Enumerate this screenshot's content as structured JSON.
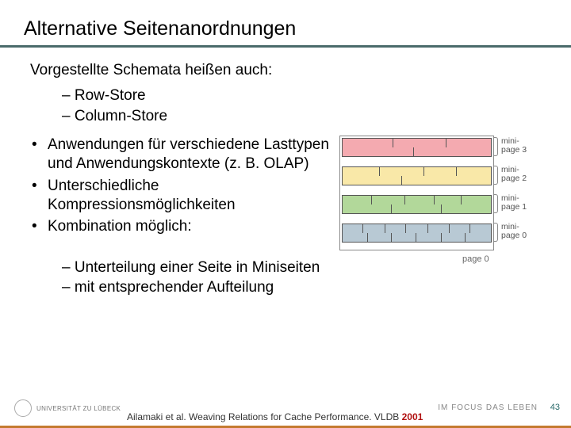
{
  "title": "Alternative Seitenanordnungen",
  "intro": "Vorgestellte Schemata heißen auch:",
  "stores": [
    "Row-Store",
    "Column-Store"
  ],
  "bullets": [
    "Anwendungen für verschiedene Lasttypen und Anwendungs­kontexte (z. B. OLAP)",
    "Unterschiedliche Kompressionsmöglichkeiten",
    "Kombination möglich:"
  ],
  "subpoints": [
    "Unterteilung einer Seite in Miniseiten",
    "mit entsprechender Aufteilung"
  ],
  "diagram": {
    "minipages": [
      {
        "label": "mini-\npage 3"
      },
      {
        "label": "mini-\npage 2"
      },
      {
        "label": "mini-\npage 1"
      },
      {
        "label": "mini-\npage 0"
      }
    ],
    "page_label": "page 0"
  },
  "citation": {
    "text": "Ailamaki et al. Weaving Relations for Cache Performance. VLDB",
    "year": "2001"
  },
  "footer": {
    "university": "UNIVERSITÄT ZU LÜBECK",
    "motto": "IM FOCUS DAS LEBEN",
    "page": "43"
  }
}
